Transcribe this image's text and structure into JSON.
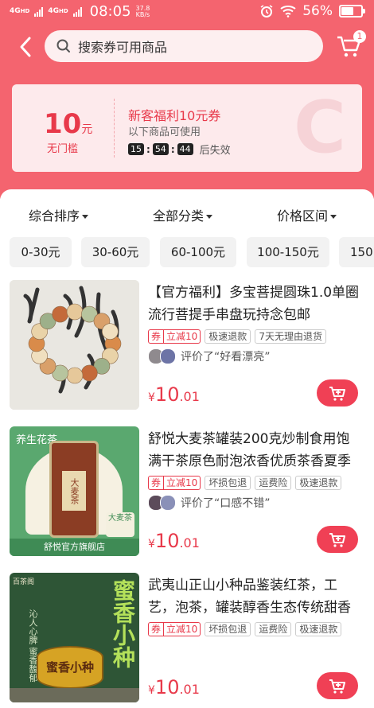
{
  "status_bar": {
    "net1": "4G",
    "net1_sub": "HD",
    "net2": "4G",
    "net2_sub": "HD",
    "time": "08:05",
    "speed_value": "37.8",
    "speed_unit": "KB/s",
    "battery": "56%",
    "battery_level": 0.56
  },
  "search": {
    "placeholder": "搜索券可用商品"
  },
  "cart": {
    "badge": "1"
  },
  "coupon": {
    "amount": "10",
    "unit": "元",
    "condition": "无门槛",
    "title": "新客福利10元券",
    "subtitle": "以下商品可使用",
    "countdown": [
      "15",
      "54",
      "44"
    ],
    "expire_text": "后失效"
  },
  "sort_options": [
    "综合排序",
    "全部分类",
    "价格区间"
  ],
  "price_chips": [
    "0-30元",
    "30-60元",
    "60-100元",
    "100-150元",
    "150"
  ],
  "products": [
    {
      "title": "【官方福利】多宝菩提圆珠1.0单圈流行菩提手串盘玩持念包邮",
      "tag_main": "券",
      "tag_value": "立减10",
      "tags": [
        "极速退款",
        "7天无理由退货"
      ],
      "review": "评价了“好看漂亮”",
      "price_symbol": "¥",
      "price_int": "10",
      "price_dec": ".01"
    },
    {
      "title": "舒悦大麦茶罐装200克炒制食用饱满干茶原色耐泡浓香优质茶香夏季",
      "tag_main": "券",
      "tag_value": "立减10",
      "tags": [
        "坏损包退",
        "运费险",
        "极速退款"
      ],
      "review": "评价了“口感不错”",
      "price_symbol": "¥",
      "price_int": "10",
      "price_dec": ".01",
      "img_label_top": "养生花茶",
      "img_can": "大麦茶",
      "img_store": "舒悦官方旗舰店",
      "img_badge": "大麦茶"
    },
    {
      "title": "武夷山正山小种品鉴装红茶，工艺，泡茶，罐装醇香生态传统甜香",
      "tag_main": "券",
      "tag_value": "立减10",
      "tags": [
        "坏损包退",
        "运费险",
        "极速退款"
      ],
      "price_symbol": "¥",
      "price_int": "10",
      "price_dec": ".01",
      "img_brand": "百茶阁",
      "img_big": "蜜香小种",
      "img_side": "沁人心脾 蜜香馥郁",
      "img_can": "蜜香小种"
    }
  ]
}
